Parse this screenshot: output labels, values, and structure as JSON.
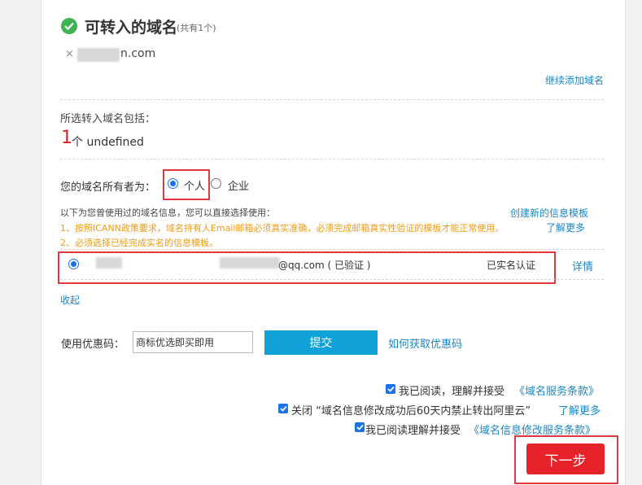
{
  "header": {
    "title": "可转入的域名",
    "subtitle": "(共有1个)"
  },
  "domain_item": {
    "remove_icon": "×",
    "visible_suffix": "n.com"
  },
  "continue_add": "继续添加域名",
  "included": {
    "label": "所选转入域名包括：",
    "count": "1",
    "count_text": "个 undefined"
  },
  "owner": {
    "label": "您的域名所有者为：",
    "options": [
      "个人",
      "企业"
    ],
    "selected": "个人"
  },
  "templates": {
    "hint": "以下为您曾使用过的域名信息，您可以直接选择使用：",
    "create_link": "创建新的信息模板",
    "warning_1": "1、按照ICANN政策要求，域名持有人Email邮箱必须真实准确，必须完成邮箱真实性验证的模板才能正常使用。",
    "learn_more_1": "了解更多",
    "warning_2": "2、必须选择已经完成实名的信息模板。",
    "row": {
      "email_suffix": "@qq.com ( 已验证 )",
      "status": "已实名认证",
      "detail_link": "详情"
    },
    "collapse_link": "收起"
  },
  "coupon": {
    "label": "使用优惠码：",
    "value": "商标优选即买即用",
    "submit": "提交",
    "howto_link": "如何获取优惠码"
  },
  "agreements": {
    "a1_text": "我已阅读，理解并接受",
    "a1_link": "《域名服务条款》",
    "a2_text": "关闭 “域名信息修改成功后60天内禁止转出阿里云”",
    "a2_link": "了解更多",
    "a3_text": "我已阅读理解并接受",
    "a3_link": "《域名信息修改服务条款》"
  },
  "next_button": "下一步",
  "colors": {
    "accent_blue": "#0fa1d8",
    "link_blue": "#1a86c8",
    "warning_orange": "#f29a10",
    "highlight_red": "#e0383f",
    "next_red": "#e8222a",
    "check_green": "#3fb34f"
  },
  "icons": {
    "title_icon": "check-circle-icon",
    "remove_icon": "close-icon"
  }
}
